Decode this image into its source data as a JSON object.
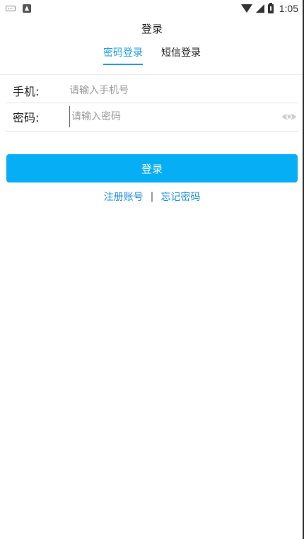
{
  "status_bar": {
    "time": "1:05",
    "left_icons": [
      "keyboard-icon",
      "notification-icon"
    ],
    "right_icons": [
      "wifi-icon",
      "signal-icon",
      "battery-icon"
    ]
  },
  "header": {
    "title": "登录"
  },
  "tabs": [
    {
      "label": "密码登录",
      "active": true
    },
    {
      "label": "短信登录",
      "active": false
    }
  ],
  "form": {
    "phone": {
      "label": "手机:",
      "placeholder": "请输入手机号",
      "value": ""
    },
    "password": {
      "label": "密码:",
      "placeholder": "请输入密码",
      "value": "",
      "toggle_icon": "eye-icon"
    }
  },
  "login_button": {
    "label": "登录"
  },
  "links": {
    "register": "注册账号",
    "separator": "|",
    "forgot": "忘记密码"
  },
  "colors": {
    "accent": "#1e9ee6",
    "button": "#05aef5",
    "link": "#1e8fe0"
  }
}
